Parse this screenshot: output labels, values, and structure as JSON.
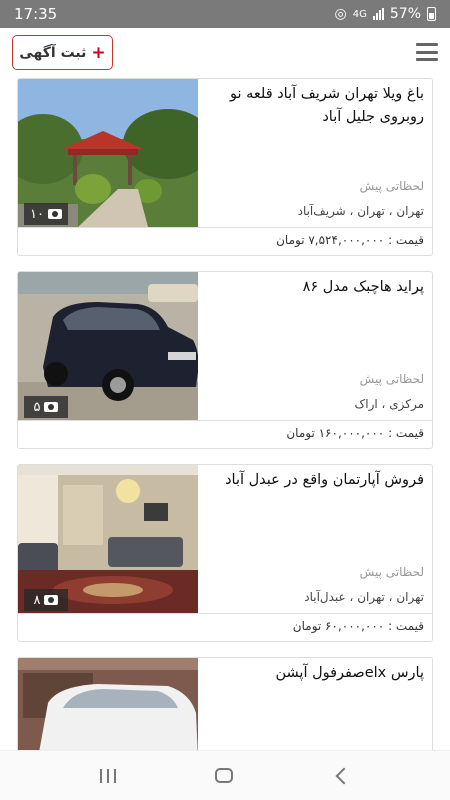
{
  "status": {
    "time": "17:35",
    "network": "4G",
    "battery": "57%"
  },
  "header": {
    "post_ad_label": "ثبت آگهی",
    "plus": "+"
  },
  "listings": [
    {
      "title": "باغ ویلا تهران شریف آباد قلعه نو روبروی جلیل آباد",
      "time": "لحظاتی پیش",
      "location": "تهران ، تهران ، شریف‌آباد",
      "price": "قیمت : ۷,۵۲۴,۰۰۰,۰۰۰ تومان",
      "photo_count": "۱۰"
    },
    {
      "title": "پراید هاچبک مدل ۸۶",
      "time": "لحظاتی پیش",
      "location": "مرکزی ، اراک",
      "price": "قیمت : ۱۶۰,۰۰۰,۰۰۰ تومان",
      "photo_count": "۵"
    },
    {
      "title": "فروش آپارتمان واقع در عبدل آباد",
      "time": "لحظاتی پیش",
      "location": "تهران ، تهران ، عبدل‌آباد",
      "price": "قیمت : ۶۰,۰۰۰,۰۰۰ تومان",
      "photo_count": "۸"
    },
    {
      "title": "پارس elxصفرفول آپشن"
    }
  ]
}
